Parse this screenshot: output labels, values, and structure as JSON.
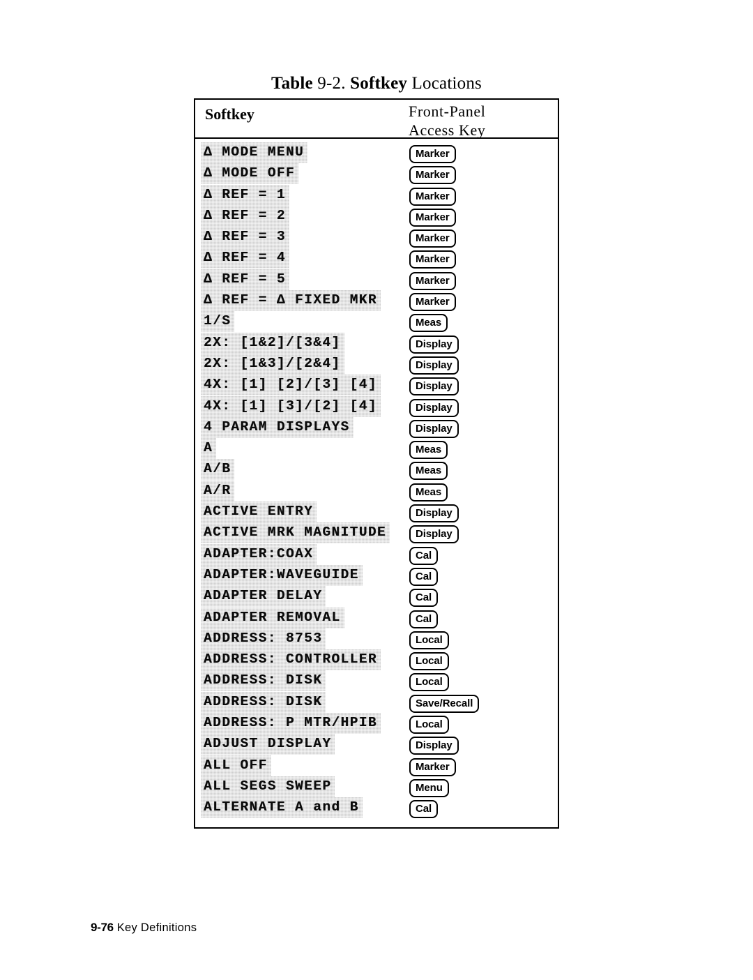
{
  "caption": {
    "prefix_bold": "Table",
    "number": " 9-2. ",
    "mid_bold": "Softkey",
    "suffix": " Locations"
  },
  "table": {
    "columns": {
      "softkey": "Softkey",
      "access_key_line1": "Front-Panel",
      "access_key_line2": "Access Key"
    },
    "rows": [
      {
        "softkey": "Δ MODE MENU",
        "access_key": "Marker"
      },
      {
        "softkey": "Δ MODE OFF",
        "access_key": "Marker"
      },
      {
        "softkey": "Δ REF = 1",
        "access_key": "Marker"
      },
      {
        "softkey": "Δ REF = 2",
        "access_key": "Marker"
      },
      {
        "softkey": "Δ REF = 3",
        "access_key": "Marker"
      },
      {
        "softkey": "Δ REF = 4",
        "access_key": "Marker"
      },
      {
        "softkey": "Δ REF = 5",
        "access_key": "Marker"
      },
      {
        "softkey": "Δ REF = Δ FIXED MKR",
        "access_key": "Marker"
      },
      {
        "softkey": "1/S",
        "access_key": "Meas"
      },
      {
        "softkey": "2X: [1&2]/[3&4]",
        "access_key": "Display"
      },
      {
        "softkey": "2X: [1&3]/[2&4]",
        "access_key": "Display"
      },
      {
        "softkey": "4X: [1] [2]/[3] [4]",
        "access_key": "Display"
      },
      {
        "softkey": "4X: [1] [3]/[2] [4]",
        "access_key": "Display"
      },
      {
        "softkey": "4 PARAM DISPLAYS",
        "access_key": "Display"
      },
      {
        "softkey": "A",
        "access_key": "Meas"
      },
      {
        "softkey": "A/B",
        "access_key": "Meas"
      },
      {
        "softkey": "A/R",
        "access_key": "Meas"
      },
      {
        "softkey": "ACTIVE ENTRY",
        "access_key": "Display"
      },
      {
        "softkey": "ACTIVE MRK MAGNITUDE",
        "access_key": "Display"
      },
      {
        "softkey": "ADAPTER:COAX",
        "access_key": "Cal"
      },
      {
        "softkey": "ADAPTER:WAVEGUIDE",
        "access_key": "Cal"
      },
      {
        "softkey": "ADAPTER DELAY",
        "access_key": "Cal"
      },
      {
        "softkey": "ADAPTER REMOVAL",
        "access_key": "Cal"
      },
      {
        "softkey": "ADDRESS: 8753",
        "access_key": "Local"
      },
      {
        "softkey": "ADDRESS: CONTROLLER",
        "access_key": "Local"
      },
      {
        "softkey": "ADDRESS: DISK",
        "access_key": "Local"
      },
      {
        "softkey": "ADDRESS: DISK",
        "access_key": "Save/Recall"
      },
      {
        "softkey": "ADDRESS: P MTR/HPIB",
        "access_key": "Local"
      },
      {
        "softkey": "ADJUST DISPLAY",
        "access_key": "Display"
      },
      {
        "softkey": "ALL OFF",
        "access_key": "Marker"
      },
      {
        "softkey": "ALL SEGS SWEEP",
        "access_key": "Menu"
      },
      {
        "softkey": "ALTERNATE A and B",
        "access_key": "Cal"
      }
    ]
  },
  "footer": {
    "page_number": "9-76",
    "section": "Key  Definitions"
  }
}
